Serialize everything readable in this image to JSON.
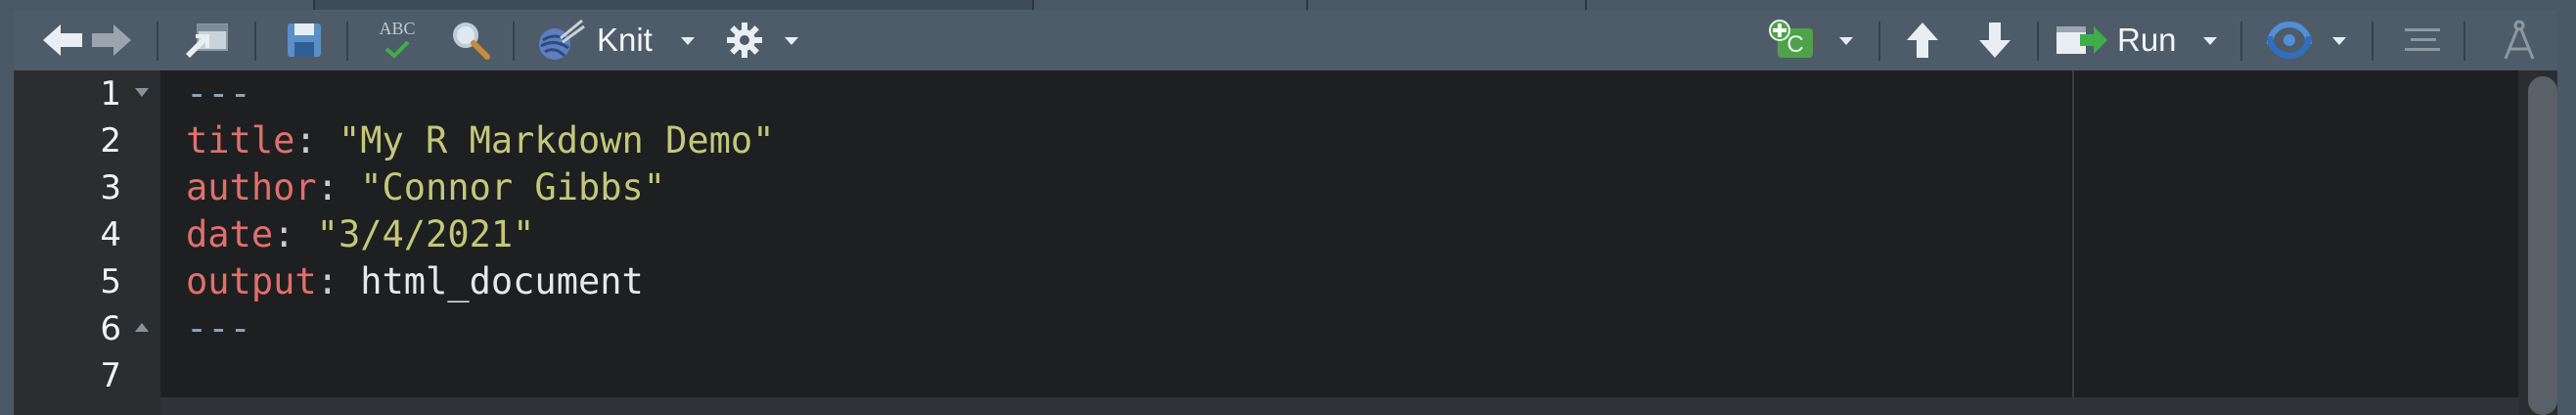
{
  "toolbar": {
    "knit_label": "Knit",
    "run_label": "Run",
    "spellcheck_label": "ABC"
  },
  "editor": {
    "lines": [
      {
        "num": "1",
        "fold": "down",
        "parts": [
          {
            "t": "---",
            "c": "d"
          }
        ]
      },
      {
        "num": "2",
        "fold": "",
        "parts": [
          {
            "t": "title",
            "c": "k"
          },
          {
            "t": ": ",
            "c": "p"
          },
          {
            "t": "\"My R Markdown Demo\"",
            "c": "s"
          }
        ]
      },
      {
        "num": "3",
        "fold": "",
        "parts": [
          {
            "t": "author",
            "c": "k"
          },
          {
            "t": ": ",
            "c": "p"
          },
          {
            "t": "\"Connor Gibbs\"",
            "c": "s"
          }
        ]
      },
      {
        "num": "4",
        "fold": "",
        "parts": [
          {
            "t": "date",
            "c": "k"
          },
          {
            "t": ": ",
            "c": "p"
          },
          {
            "t": "\"3/4/2021\"",
            "c": "s"
          }
        ]
      },
      {
        "num": "5",
        "fold": "",
        "parts": [
          {
            "t": "output",
            "c": "k"
          },
          {
            "t": ": ",
            "c": "p"
          },
          {
            "t": "html_document",
            "c": "w"
          }
        ]
      },
      {
        "num": "6",
        "fold": "up",
        "parts": [
          {
            "t": "---",
            "c": "d"
          }
        ]
      },
      {
        "num": "7",
        "fold": "",
        "parts": []
      }
    ]
  },
  "colors": {
    "toolbar_bg": "#4e5c6a",
    "editor_bg": "#1e1f21",
    "yaml_key": "#e0706b",
    "yaml_string": "#c3c879"
  }
}
